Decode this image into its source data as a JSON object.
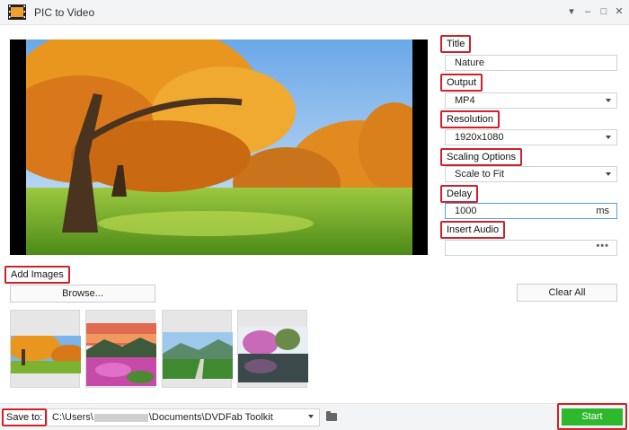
{
  "window": {
    "title": "PIC to Video",
    "controls": [
      "dropdown-icon",
      "minimize-icon",
      "maximize-icon",
      "close-icon"
    ]
  },
  "settings": {
    "title_label": "Title",
    "title_value": "Nature",
    "output_label": "Output",
    "output_value": "MP4",
    "resolution_label": "Resolution",
    "resolution_value": "1920x1080",
    "scaling_label": "Scaling Options",
    "scaling_value": "Scale to Fit",
    "delay_label": "Delay",
    "delay_value": "1000",
    "delay_unit": "ms",
    "audio_label": "Insert Audio",
    "audio_browse": "•••"
  },
  "images": {
    "section_label": "Add Images",
    "browse_label": "Browse...",
    "clear_label": "Clear All",
    "thumbnails": [
      "autumn-park",
      "sunset-flowers",
      "mountain-path",
      "cherry-pond"
    ]
  },
  "footer": {
    "save_label": "Save to:",
    "path_prefix": "C:\\Users\\",
    "path_suffix": "\\Documents\\DVDFab Toolkit",
    "start_label": "Start"
  },
  "colors": {
    "accent_red": "#d0202a",
    "start_green": "#2eb82e"
  }
}
